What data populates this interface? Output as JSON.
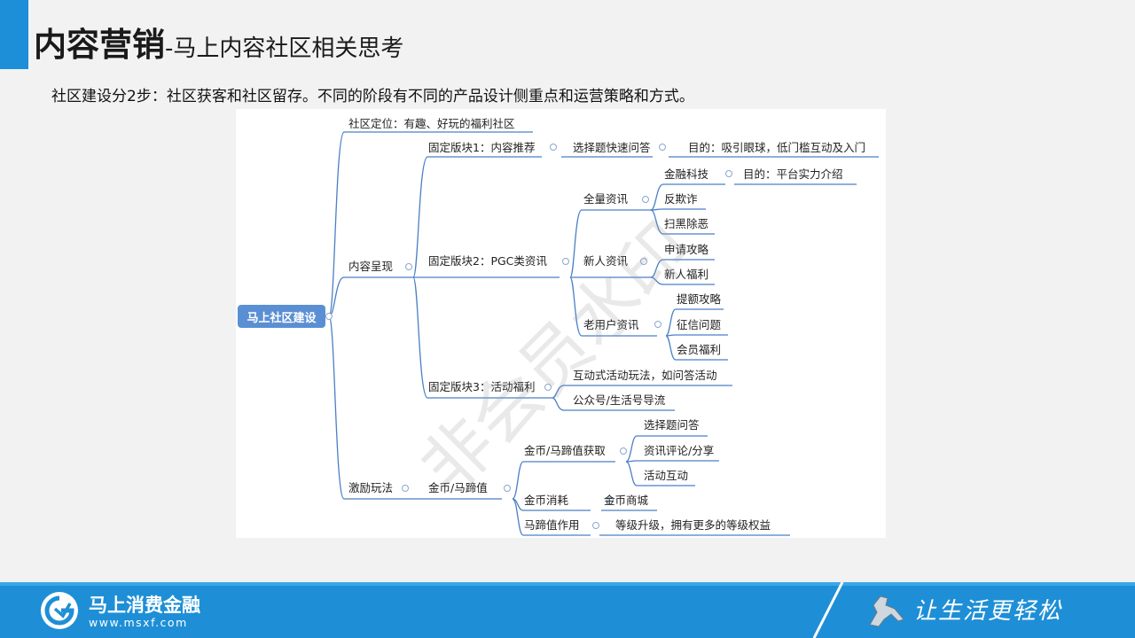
{
  "header": {
    "title_main": "内容营销",
    "title_sub": "-马上内容社区相关思考"
  },
  "subtitle": "社区建设分2步：社区获客和社区留存。不同的阶段有不同的产品设计侧重点和运营策略和方式。",
  "mindmap": {
    "root": "马上社区建设",
    "watermark": "非会员水印",
    "nodes": {
      "positioning": "社区定位：有趣、好玩的福利社区",
      "content": "内容呈现",
      "incentive": "激励玩法",
      "block1": "固定版块1：内容推荐",
      "block1_child": "选择题快速问答",
      "block1_goal": "目的：吸引眼球，低门槛互动及入门",
      "block2": "固定版块2：PGC类资讯",
      "all_news": "全量资讯",
      "fintech": "金融科技",
      "fintech_goal": "目的：平台实力介绍",
      "anti_fraud": "反欺诈",
      "anti_crime": "扫黑除恶",
      "new_user_news": "新人资讯",
      "apply_guide": "申请攻略",
      "new_user_benefit": "新人福利",
      "old_user_news": "老用户资讯",
      "limit_guide": "提额攻略",
      "credit_issue": "征信问题",
      "member_benefit": "会员福利",
      "block3": "固定版块3：活动福利",
      "interactive": "互动式活动玩法，如问答活动",
      "wechat_flow": "公众号/生活号导流",
      "coins": "金币/马蹄值",
      "earn": "金币/马蹄值获取",
      "earn_q": "选择题问答",
      "earn_comment": "资讯评论/分享",
      "earn_activity": "活动互动",
      "spend": "金币消耗",
      "mall": "金币商城",
      "hoof_use": "马蹄值作用",
      "hoof_use_desc": "等级升级，拥有更多的等级权益"
    }
  },
  "footer": {
    "brand_name": "马上消费金融",
    "brand_url": "www.msxf.com",
    "slogan": "让生活更轻松"
  },
  "colors": {
    "accent": "#1d8ed8",
    "node_line": "#4a7fc6",
    "root_bg": "#5b8fd3"
  }
}
